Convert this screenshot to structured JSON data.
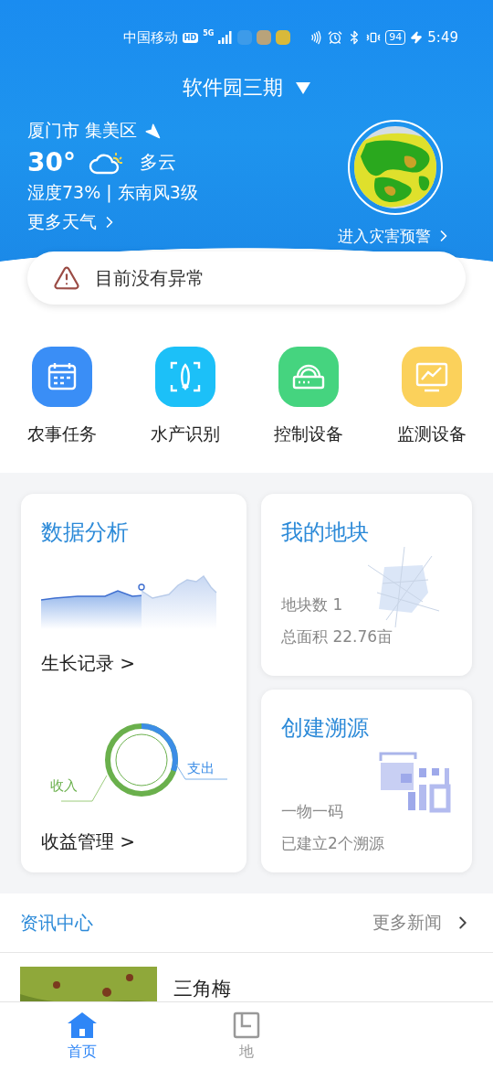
{
  "status_bar": {
    "carrier": "中国移动",
    "badges": [
      "HD",
      "5G"
    ],
    "battery": "94",
    "time": "5:49"
  },
  "location_selector": {
    "label": "软件园三期"
  },
  "weather": {
    "place": "厦门市 集美区",
    "temperature": "30°",
    "condition": "多云",
    "details": "湿度73% | 东南风3级",
    "more_link": "更多天气"
  },
  "disaster_warning": {
    "label": "进入灾害预警"
  },
  "alert": {
    "text": "目前没有异常"
  },
  "shortcuts": [
    {
      "label": "农事任务",
      "kind": "calendar",
      "color": "#3a8ef6"
    },
    {
      "label": "水产识别",
      "kind": "fish",
      "color": "#1cc0f8"
    },
    {
      "label": "控制设备",
      "kind": "router",
      "color": "#45d47f"
    },
    {
      "label": "监测设备",
      "kind": "monitor",
      "color": "#fbd15b"
    }
  ],
  "data_analysis": {
    "title": "数据分析",
    "growth_link": "生长记录 >",
    "income_label": "收入",
    "expense_label": "支出",
    "revenue_link": "收益管理 >"
  },
  "my_plots": {
    "title": "我的地块",
    "plot_count": "地块数 1",
    "total_area": "总面积 22.76亩"
  },
  "traceability": {
    "title": "创建溯源",
    "subtitle": "一物一码",
    "count": "已建立2个溯源"
  },
  "news": {
    "title": "资讯中心",
    "more": "更多新闻",
    "items": [
      {
        "title": "三角梅"
      }
    ]
  },
  "tab_bar": [
    {
      "label": "首页",
      "kind": "home",
      "selected": true
    },
    {
      "label": "地",
      "kind": "plot",
      "selected": false
    }
  ]
}
